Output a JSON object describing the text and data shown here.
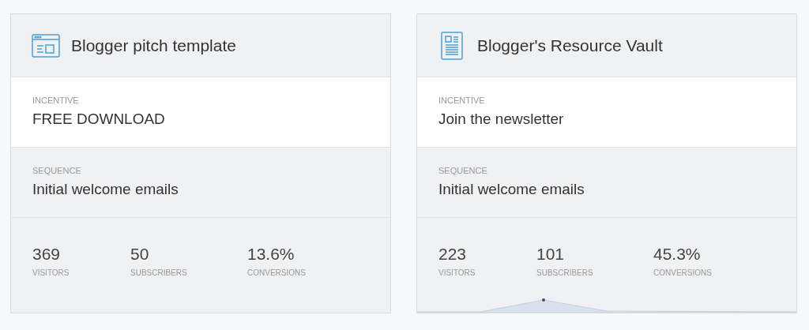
{
  "cards": [
    {
      "title": "Blogger pitch template",
      "kind": "browser",
      "incentive_label": "INCENTIVE",
      "incentive": "FREE DOWNLOAD",
      "sequence_label": "SEQUENCE",
      "sequence": "Initial welcome emails",
      "stats": [
        {
          "value": "369",
          "label": "VISITORS"
        },
        {
          "value": "50",
          "label": "SUBSCRIBERS"
        },
        {
          "value": "13.6%",
          "label": "CONVERSIONS"
        }
      ],
      "sparkline": false
    },
    {
      "title": "Blogger's Resource Vault",
      "kind": "document",
      "incentive_label": "INCENTIVE",
      "incentive": "Join the newsletter",
      "sequence_label": "SEQUENCE",
      "sequence": "Initial welcome emails",
      "stats": [
        {
          "value": "223",
          "label": "VISITORS"
        },
        {
          "value": "101",
          "label": "SUBSCRIBERS"
        },
        {
          "value": "45.3%",
          "label": "CONVERSIONS"
        }
      ],
      "sparkline": true
    }
  ]
}
